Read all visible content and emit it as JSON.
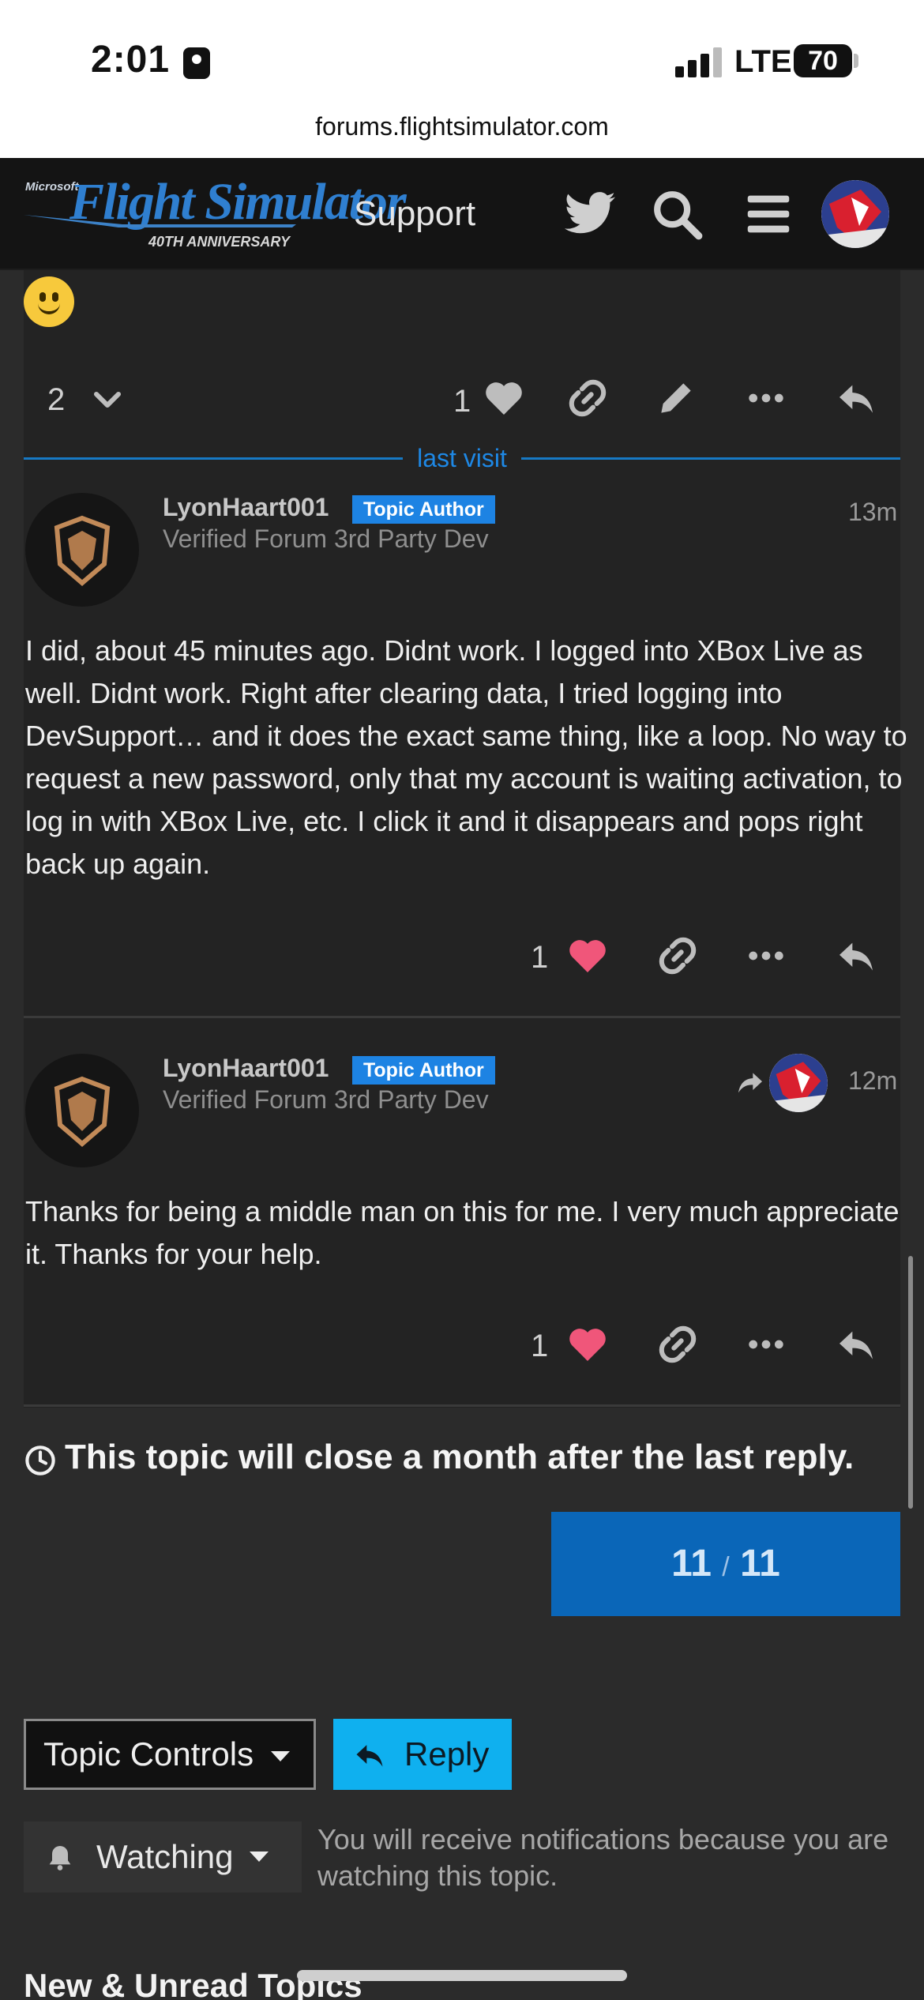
{
  "status_bar": {
    "time": "2:01",
    "network": "LTE",
    "battery": "70"
  },
  "browser": {
    "url": "forums.flightsimulator.com"
  },
  "header": {
    "logo_small": "Microsoft",
    "logo_main": "Flight Simulator",
    "logo_sub": "40TH ANNIVERSARY",
    "section": "Support",
    "icons": [
      "twitter-icon",
      "search-icon",
      "hamburger-menu-icon",
      "user-avatar"
    ]
  },
  "previous_post_bar": {
    "replies_count": "2",
    "like_count": "1"
  },
  "last_visit_label": "last visit",
  "posts": [
    {
      "username": "LyonHaart001",
      "badge": "Topic Author",
      "title": "Verified Forum 3rd Party Dev",
      "time_ago": "13m",
      "text": "I did, about 45 minutes ago. Didnt work. I logged into XBox Live as well. Didnt work. Right after clearing data, I tried logging into DevSupport… and it does the exact same thing, like a loop. No way to request a new password, only that my account is waiting activation, to log in with XBox Live, etc. I click it and it disappears and pops right back up again.",
      "likes": "1"
    },
    {
      "username": "LyonHaart001",
      "badge": "Topic Author",
      "title": "Verified Forum 3rd Party Dev",
      "time_ago": "12m",
      "text": "Thanks for being a middle man on this for me. I very much appreciate it. Thanks for your help.",
      "likes": "1"
    }
  ],
  "close_notice": "This topic will close a month after the last reply.",
  "progress": {
    "current": "11",
    "separator": "/",
    "total": "11"
  },
  "controls": {
    "topic_controls": "Topic Controls",
    "reply": "Reply",
    "watching": "Watching",
    "watching_note": "You will receive notifications because you are watching this topic."
  },
  "footer_heading": "New & Unread Topics",
  "colors": {
    "accent_blue": "#1d83e3",
    "reply_button": "#0fb0ef",
    "progress_bg": "#0a66b8",
    "like_heart": "#f0567a"
  }
}
